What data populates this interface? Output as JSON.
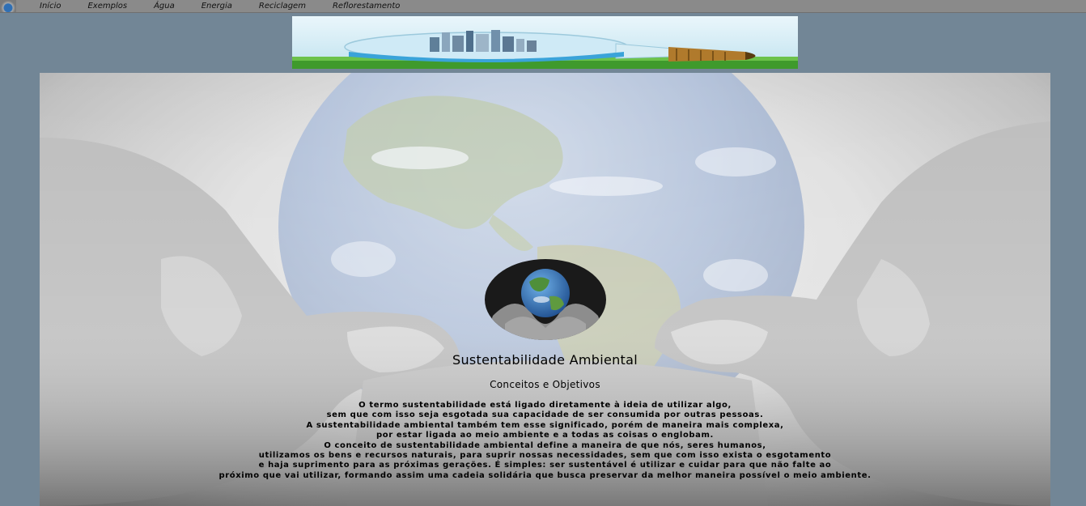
{
  "nav": {
    "items": [
      "Início",
      "Exemplos",
      "Água",
      "Energia",
      "Reciclagem",
      "Reflorestamento"
    ]
  },
  "icons": {
    "nav_logo": "earth-in-hands-icon",
    "emblem": "earth-in-hands-icon"
  },
  "colors": {
    "page_background": "#728696",
    "navbar": "#8a8a8a",
    "text": "#000000"
  },
  "main": {
    "title": "Sustentabilidade Ambiental",
    "subtitle": "Conceitos e Objetivos",
    "paragraph_lines": [
      "O termo sustentabilidade está ligado diretamente à ideia de utilizar algo,",
      "sem que com isso seja esgotada sua capacidade de ser consumida por outras pessoas.",
      "A sustentabilidade ambiental também tem esse significado, porém de maneira mais complexa,",
      "por estar ligada ao meio ambiente e a todas as coisas o englobam.",
      "O conceito de sustentabilidade ambiental define a maneira de que nós, seres humanos,",
      "utilizamos os bens e recursos naturais, para suprir nossas necessidades, sem que com isso exista o esgotamento",
      "e haja suprimento para as próximas gerações. É simples: ser sustentável é utilizar e cuidar para que não falte ao",
      "próximo que vai utilizar, formando assim uma cadeia solidária que busca preservar da melhor maneira possível o meio ambiente."
    ]
  }
}
